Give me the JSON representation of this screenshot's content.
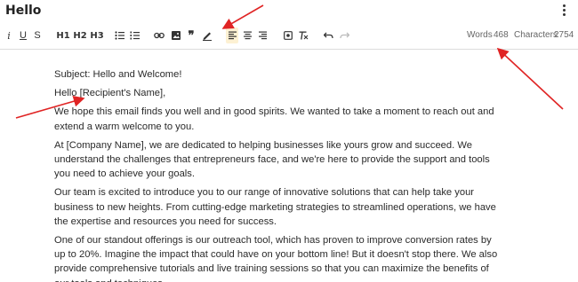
{
  "document": {
    "title": "Hello"
  },
  "toolbar": {
    "italic": "i",
    "underline": "U",
    "strike": "S",
    "h1": "H1",
    "h2": "H2",
    "h3": "H3",
    "words_label": "Words",
    "words_value": "468",
    "characters_label": "Characters",
    "characters_value": "2754"
  },
  "icons": [
    "bullet-list-icon",
    "numbered-list-icon",
    "link-icon",
    "image-icon",
    "quote-icon",
    "pen-icon",
    "align-left-icon",
    "align-center-icon",
    "align-right-icon",
    "embed-icon",
    "clear-format-icon",
    "undo-icon",
    "redo-icon",
    "more-vertical-icon"
  ],
  "accent_colors": {
    "active_button_bg": "#fdf1d3",
    "annotation_arrow": "#e02424"
  },
  "body": {
    "subject": "Subject: Hello and Welcome!",
    "greeting": "Hello [Recipient's Name],",
    "paragraphs": [
      "We hope this email finds you well and in good spirits. We wanted to take a moment to reach out and extend a warm welcome to you.",
      "At [Company Name], we are dedicated to helping businesses like yours grow and succeed. We understand the challenges that entrepreneurs face, and we're here to provide the support and tools you need to achieve your goals.",
      "Our team is excited to introduce you to our range of innovative solutions that can help take your business to new heights. From cutting-edge marketing strategies to streamlined operations, we have the expertise and resources you need for success.",
      "One of our standout offerings is our outreach tool, which has proven to improve conversion rates by up to 20%. Imagine the impact that could have on your bottom line! But it doesn't stop there. We also provide comprehensive tutorials and live training sessions so that you can maximize the benefits of our tools and techniques."
    ]
  }
}
